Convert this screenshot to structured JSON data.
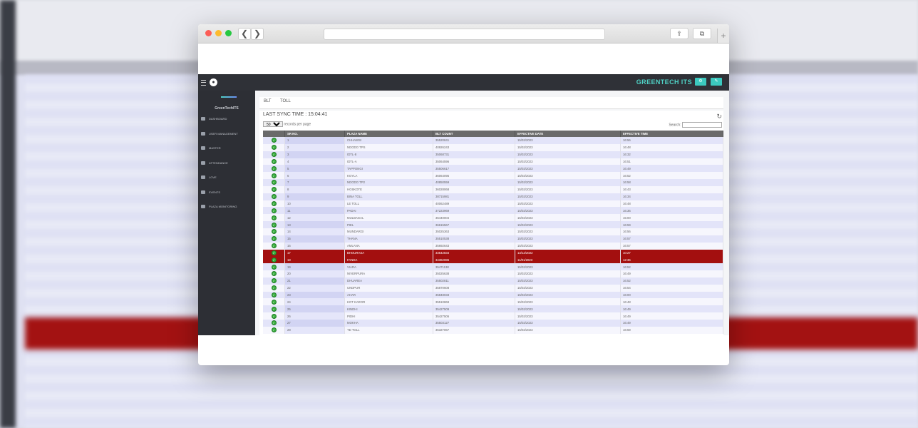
{
  "browser": {
    "back_glyph": "❮",
    "forward_glyph": "❯",
    "share_glyph": "⇪",
    "tabs_glyph": "⧉",
    "new_tab_glyph": "+"
  },
  "topbar": {
    "brand": "GREENTECH ITS",
    "gear_glyph": "⚙",
    "tool_glyph": "✎",
    "user_glyph": "●"
  },
  "sidebar": {
    "app_name": "GreenTechITS",
    "items": [
      {
        "label": "DASHBOARD",
        "icon": "monitor-icon"
      },
      {
        "label": "USER MANAGEMENT",
        "icon": "users-icon"
      },
      {
        "label": "MASTER",
        "icon": "pin-icon"
      },
      {
        "label": "ATTENDANCE",
        "icon": "id-card-icon"
      },
      {
        "label": "LOVE",
        "icon": "heart-icon"
      },
      {
        "label": "EVENTS",
        "icon": "cloud-icon"
      },
      {
        "label": "PLAZA MONITORING",
        "icon": "cloud-icon"
      }
    ]
  },
  "tabs": [
    "BLT",
    "TOLL"
  ],
  "panel": {
    "sync_text": "LAST SYNC TIME : 15:04:41",
    "records_per_page": "records per page",
    "page_size": "50",
    "search_label": "Search:",
    "refresh_glyph": "↻"
  },
  "table": {
    "columns": [
      "",
      "SR NO.",
      "PLAZA NAME",
      "BLT COUNT",
      "EFFECTIVE DATE",
      "EFFECTIVE TIME"
    ],
    "rows": [
      [
        "1",
        "CHHAWSI",
        "35520841",
        "15/02/2023",
        "16:56"
      ],
      [
        "2",
        "NDODO TPS",
        "40926243",
        "15/02/2023",
        "16:48"
      ],
      [
        "3",
        "IDTL-8",
        "35068731",
        "15/02/2023",
        "16:32"
      ],
      [
        "4",
        "IDTL-A",
        "35064596",
        "15/02/2023",
        "16:51"
      ],
      [
        "5",
        "TAPPONGI",
        "35506617",
        "15/02/2023",
        "16:49"
      ],
      [
        "6",
        "KOYLA",
        "36064095",
        "15/02/2023",
        "16:52"
      ],
      [
        "7",
        "NDODO TP2",
        "40850559",
        "15/02/2023",
        "16:58"
      ],
      [
        "8",
        "HOSKOTE",
        "36028068",
        "15/02/2023",
        "16:43"
      ],
      [
        "9",
        "BINA TOLL",
        "38715981",
        "15/02/2023",
        "16:34"
      ],
      [
        "10",
        "LE TOLL",
        "40062489",
        "15/02/2023",
        "16:48"
      ],
      [
        "11",
        "PADAI",
        "37223969",
        "15/02/2023",
        "16:36"
      ],
      [
        "12",
        "MULBAGAL",
        "36440004",
        "15/02/2023",
        "15:00"
      ],
      [
        "13",
        "PIEL",
        "36615567",
        "15/02/2023",
        "16:59"
      ],
      [
        "14",
        "MUNDARGI",
        "35025363",
        "15/02/2023",
        "16:56"
      ],
      [
        "15",
        "THANA",
        "35510538",
        "15/02/2023",
        "16:57"
      ],
      [
        "16",
        "AMLANA",
        "35692643",
        "15/02/2023",
        "16:57"
      ],
      [
        "17",
        "BHOURASA",
        "33542834",
        "13/12/2022",
        "10:27"
      ],
      [
        "18",
        "FANDA",
        "34362086",
        "11/01/2023",
        "12:36"
      ],
      [
        "19",
        "VIARA",
        "35471138",
        "15/02/2023",
        "16:52"
      ],
      [
        "20",
        "NIVERPURA",
        "35025638",
        "15/02/2023",
        "16:49"
      ],
      [
        "21",
        "DHUAREA",
        "35502811",
        "15/02/2023",
        "16:52"
      ],
      [
        "22",
        "UNDPUR",
        "35870608",
        "15/02/2023",
        "16:54"
      ],
      [
        "23",
        "AHAR",
        "35848033",
        "15/02/2023",
        "16:00"
      ],
      [
        "24",
        "KOT KAROR",
        "35510869",
        "15/02/2023",
        "16:48"
      ],
      [
        "25",
        "KINDHI",
        "35427509",
        "15/02/2023",
        "16:49"
      ],
      [
        "26",
        "PIDHI",
        "35427506",
        "15/02/2023",
        "16:49"
      ],
      [
        "27",
        "MOKHA",
        "35503127",
        "15/02/2023",
        "16:49"
      ],
      [
        "28",
        "TD TOLL",
        "36327067",
        "15/02/2023",
        "16:59"
      ]
    ],
    "highlighted_rows": [
      16,
      17
    ],
    "status_glyph": "✓"
  }
}
